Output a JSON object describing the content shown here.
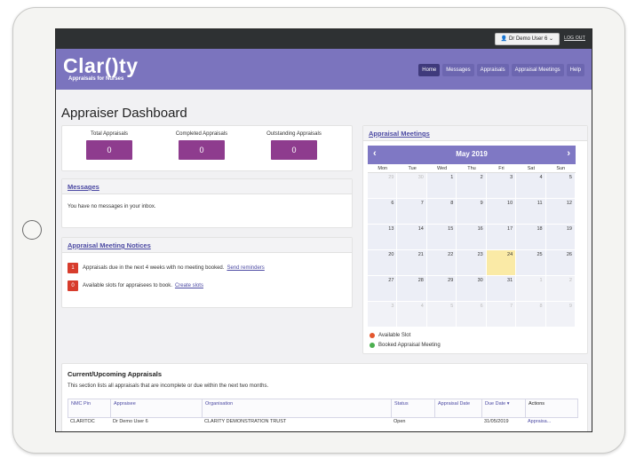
{
  "app": {
    "logo": "Clar()ty",
    "logo_sub": "Appraisals for Nurses"
  },
  "topbar": {
    "user_menu": "Dr Demo User 6",
    "logout": "LOG OUT"
  },
  "nav": [
    "Home",
    "Messages",
    "Appraisals",
    "Appraisal Meetings",
    "Help"
  ],
  "page_title": "Appraiser Dashboard",
  "stats": [
    {
      "label": "Total Appraisals",
      "value": "0"
    },
    {
      "label": "Completed Appraisals",
      "value": "0"
    },
    {
      "label": "Outstanding Appraisals",
      "value": "0"
    }
  ],
  "messages": {
    "title": "Messages",
    "text": "You have no messages in your inbox."
  },
  "notices": {
    "title": "Appraisal Meeting Notices",
    "items": [
      {
        "count": "1",
        "text": "Appraisals due in the next 4 weeks with no meeting booked.",
        "link": "Send reminders"
      },
      {
        "count": "0",
        "text": "Available slots for appraisees to book.",
        "link": "Create slots"
      }
    ]
  },
  "calendar": {
    "title": "Appraisal Meetings",
    "month": "May 2019",
    "prev": "‹",
    "next": "›",
    "weekdays": [
      "Mon",
      "Tue",
      "Wed",
      "Thu",
      "Fri",
      "Sat",
      "Sun"
    ],
    "days": [
      [
        "29",
        "30",
        "1",
        "2",
        "3",
        "4",
        "5"
      ],
      [
        "6",
        "7",
        "8",
        "9",
        "10",
        "11",
        "12"
      ],
      [
        "13",
        "14",
        "15",
        "16",
        "17",
        "18",
        "19"
      ],
      [
        "20",
        "21",
        "22",
        "23",
        "24",
        "25",
        "26"
      ],
      [
        "27",
        "28",
        "29",
        "30",
        "31",
        "1",
        "2"
      ],
      [
        "3",
        "4",
        "5",
        "6",
        "7",
        "8",
        "9"
      ]
    ],
    "highlight": "24",
    "legend": [
      {
        "label": "Available Slot",
        "color": "#e4572e"
      },
      {
        "label": "Booked Appraisal Meeting",
        "color": "#4caf50"
      }
    ]
  },
  "appraisals": {
    "title": "Current/Upcoming Appraisals",
    "description": "This section lists all appraisals that are incomplete or due within the next two months.",
    "columns": [
      "NMC Pin",
      "Appraisee",
      "Organisation",
      "Status",
      "Appraisal Date",
      "Due Date ▾",
      "Actions"
    ],
    "row": [
      "CLARITOC",
      "Dr Demo User 6",
      "CLARITY DEMONSTRATION TRUST",
      "Open",
      "",
      "31/05/2019",
      "Appraisa..."
    ]
  },
  "colors": {
    "header": "#7b74be",
    "topbar": "#2e3133",
    "stat_box": "#8e3c8e",
    "notice_badge": "#d73c2c",
    "calendar_header": "#7f78c4",
    "today": "#faeaa6"
  }
}
